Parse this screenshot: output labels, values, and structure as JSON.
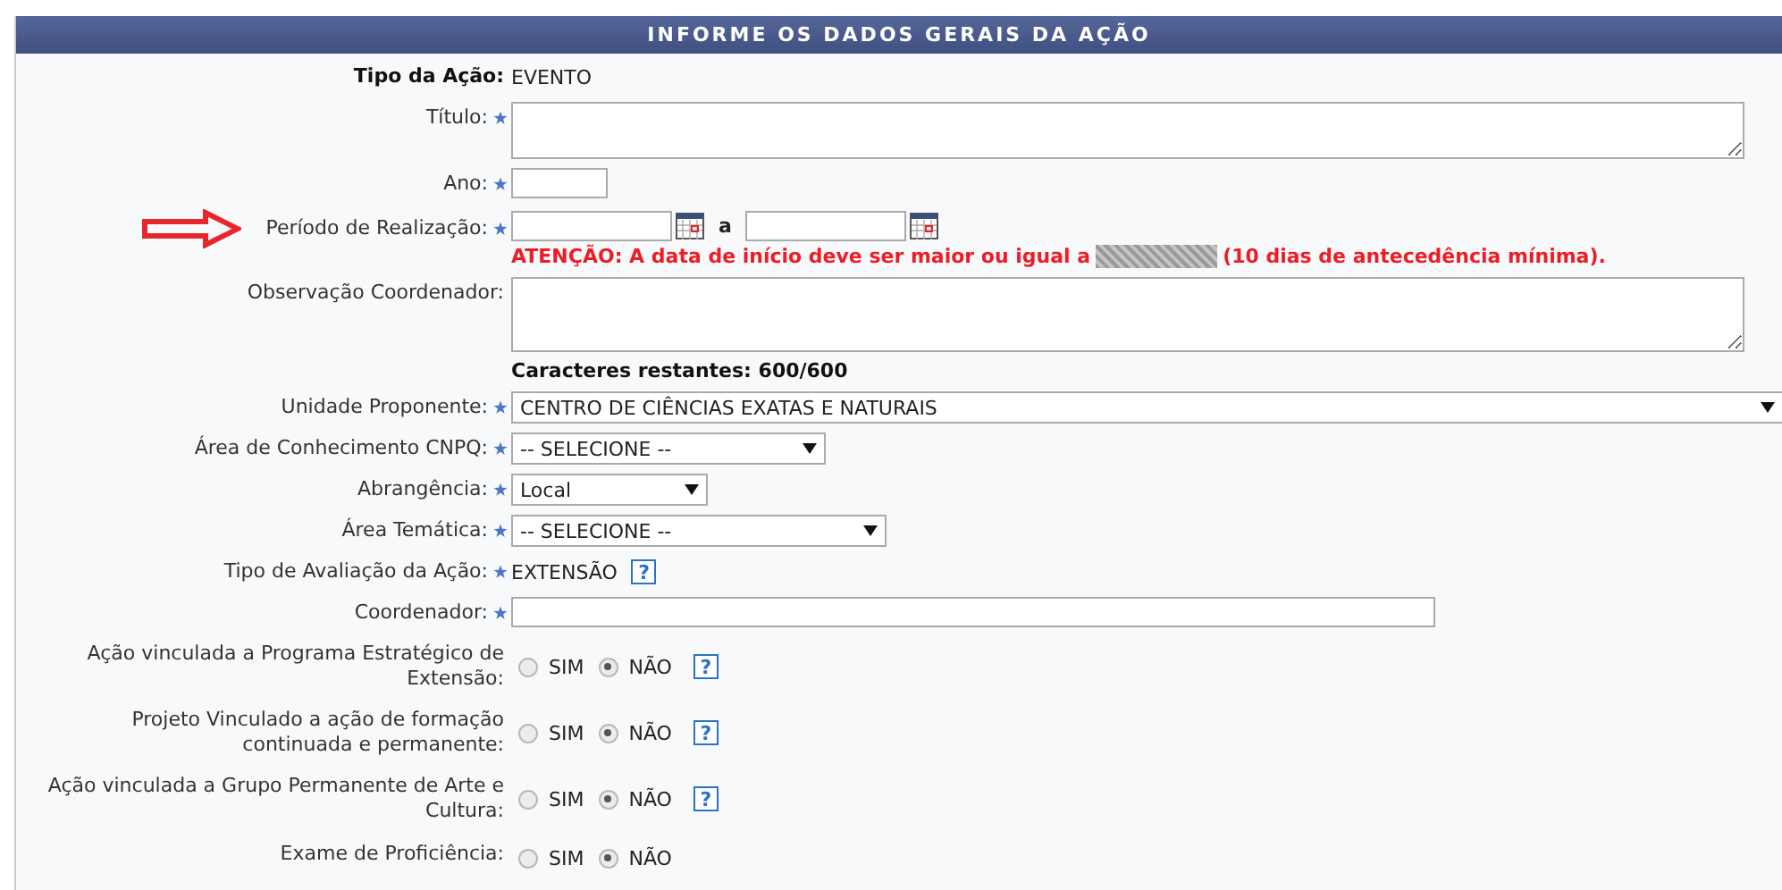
{
  "header": {
    "title": "INFORME OS DADOS GERAIS DA AÇÃO"
  },
  "fields": [
    {
      "kind": "static",
      "label": "Tipo da Ação:",
      "required": false,
      "value": "EVENTO"
    },
    {
      "kind": "textarea",
      "label": "Título:",
      "required": true
    },
    {
      "kind": "input",
      "label": "Ano:",
      "required": true
    },
    {
      "kind": "date_range",
      "label": "Período de Realização:",
      "required": true,
      "pointer_arrow": true,
      "separator": "a",
      "warning_before": "ATENÇÃO: A data de início deve ser maior ou igual a",
      "redacted": true,
      "warning_after": "(10 dias de antecedência mínima)."
    },
    {
      "kind": "textarea",
      "label": "Observação Coordenador:",
      "required": false,
      "counter": "Caracteres restantes: 600/600"
    },
    {
      "kind": "select",
      "label": "Unidade Proponente:",
      "required": true,
      "value": "CENTRO DE CIÊNCIAS EXATAS E NATURAIS"
    },
    {
      "kind": "select",
      "label": "Área de Conhecimento CNPQ:",
      "required": true,
      "value": "-- SELECIONE --"
    },
    {
      "kind": "select",
      "label": "Abrangência:",
      "required": true,
      "value": "Local"
    },
    {
      "kind": "select",
      "label": "Área Temática:",
      "required": true,
      "value": "-- SELECIONE --"
    },
    {
      "kind": "static",
      "label": "Tipo de Avaliação da Ação:",
      "required": true,
      "value": "EXTENSÃO",
      "help": "?"
    },
    {
      "kind": "input",
      "label": "Coordenador:",
      "required": true
    },
    {
      "kind": "radio",
      "label": "Ação vinculada a Programa Estratégico de Extensão:",
      "required": false,
      "options": [
        {
          "label": "SIM",
          "selected": false
        },
        {
          "label": "NÃO",
          "selected": true
        }
      ],
      "help": "?"
    },
    {
      "kind": "radio",
      "label": "Projeto Vinculado a ação de formação continuada e permanente:",
      "required": false,
      "options": [
        {
          "label": "SIM",
          "selected": false
        },
        {
          "label": "NÃO",
          "selected": true
        }
      ],
      "help": "?"
    },
    {
      "kind": "radio",
      "label": "Ação vinculada a Grupo Permanente de Arte e Cultura:",
      "required": false,
      "options": [
        {
          "label": "SIM",
          "selected": false
        },
        {
          "label": "NÃO",
          "selected": true
        }
      ],
      "help": "?"
    },
    {
      "kind": "radio",
      "label": "Exame de Proficiência:",
      "required": false,
      "options": [
        {
          "label": "SIM",
          "selected": false
        },
        {
          "label": "NÃO",
          "selected": true
        }
      ]
    }
  ]
}
